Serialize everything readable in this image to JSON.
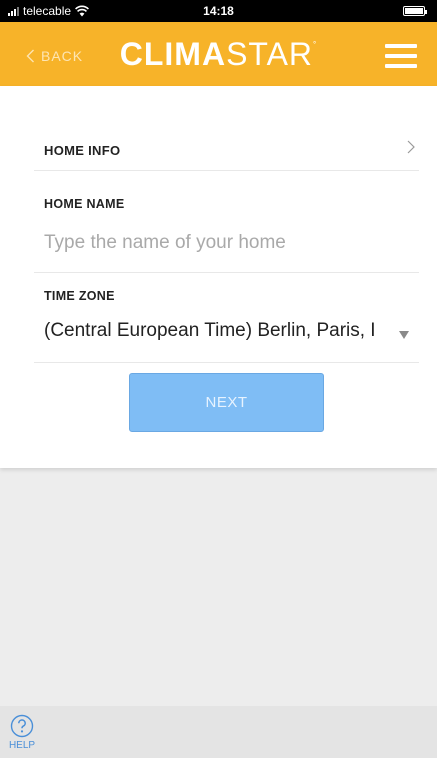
{
  "status_bar": {
    "carrier": "telecable",
    "time": "14:18"
  },
  "header": {
    "back_label": "BACK",
    "brand_bold": "CLIMA",
    "brand_light": "STAR",
    "brand_mark": "°"
  },
  "home_info": {
    "label": "HOME INFO"
  },
  "home_name": {
    "label": "HOME NAME",
    "value": "",
    "placeholder": "Type the name of your home"
  },
  "time_zone": {
    "label": "TIME ZONE",
    "value": "(Central European Time) Berlin, Paris, I"
  },
  "next_button": {
    "label": "NEXT"
  },
  "footer": {
    "help_label": "HELP"
  },
  "colors": {
    "header_bg": "#f7b329",
    "next_button_bg": "#7fbdf5",
    "help_blue": "#4a8fd8"
  },
  "icons": [
    "signal-icon",
    "wifi-icon",
    "battery-icon",
    "back-chevron-icon",
    "menu-icon",
    "chevron-right-icon",
    "dropdown-arrow-icon",
    "help-icon"
  ]
}
